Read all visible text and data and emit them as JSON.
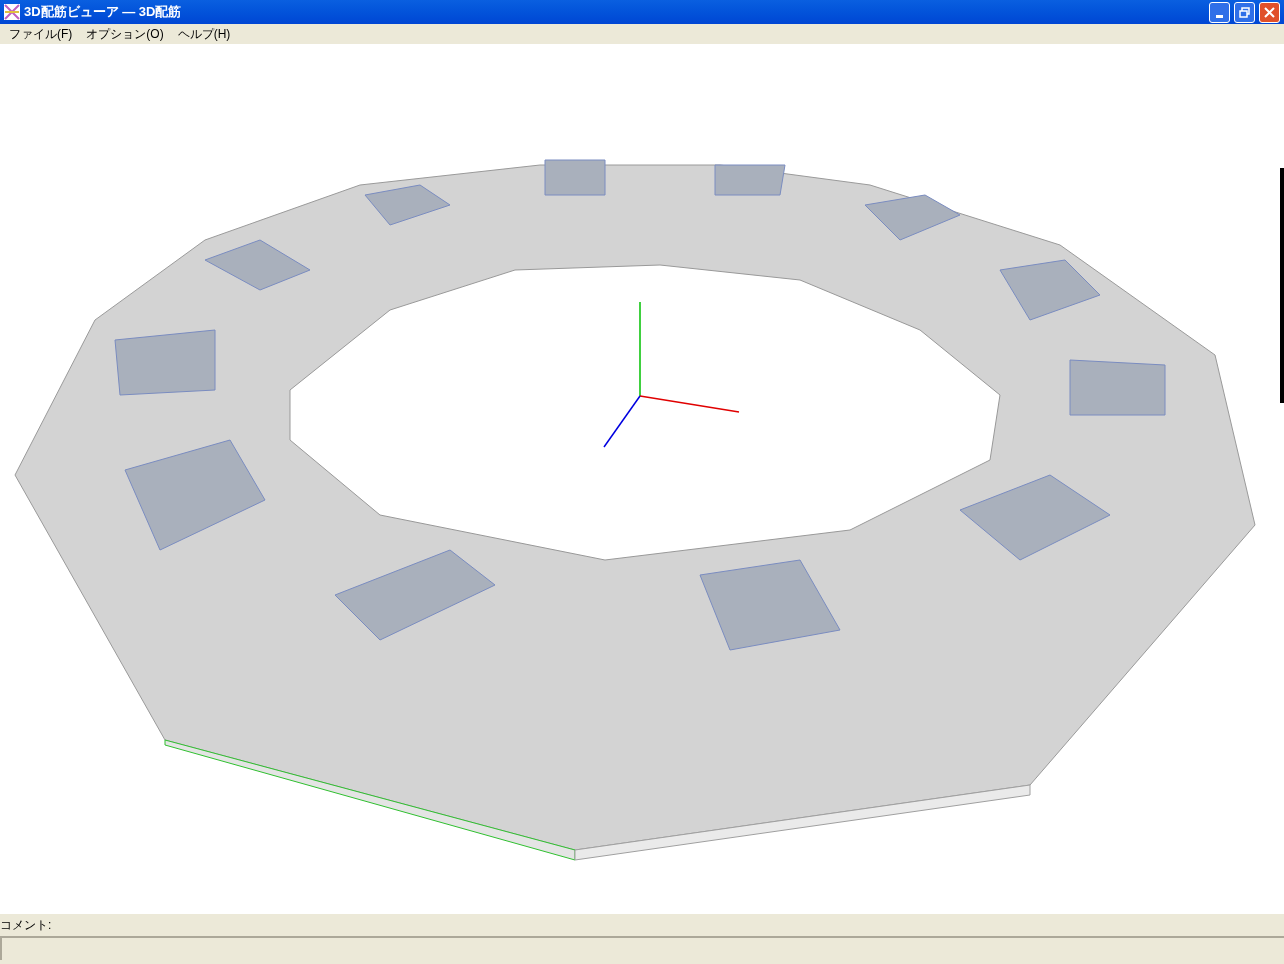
{
  "window": {
    "title": "3D配筋ビューア — 3D配筋"
  },
  "menu": [
    {
      "label": "ファイル(F)"
    },
    {
      "label": "オプション(O)"
    },
    {
      "label": "ヘルプ(H)"
    }
  ],
  "comment": {
    "label": "コメント:"
  }
}
